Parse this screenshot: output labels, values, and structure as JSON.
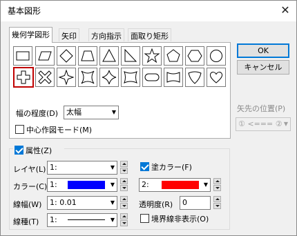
{
  "window": {
    "title": "基本図形",
    "close": "✕"
  },
  "tabs": [
    {
      "label": "幾何学図形"
    },
    {
      "label": "矢印"
    },
    {
      "label": "方向指示"
    },
    {
      "label": "面取り矩形"
    }
  ],
  "shapes": [
    {
      "icon": "rectangle-icon"
    },
    {
      "icon": "parallelogram-icon"
    },
    {
      "icon": "diamond-icon"
    },
    {
      "icon": "trapezoid-icon"
    },
    {
      "icon": "triangle-icon"
    },
    {
      "icon": "right-triangle-icon"
    },
    {
      "icon": "star-icon"
    },
    {
      "icon": "pentagon-icon"
    },
    {
      "icon": "hexagon-icon"
    },
    {
      "icon": "circle-icon"
    },
    {
      "icon": "cross-icon",
      "selected": true
    },
    {
      "icon": "x-cross-icon"
    },
    {
      "icon": "four-point-star-icon"
    },
    {
      "icon": "concave-square-icon"
    },
    {
      "icon": "concave-diamond-icon"
    },
    {
      "icon": "concave-rectangle-icon"
    },
    {
      "icon": "stadium-icon"
    },
    {
      "icon": "double-wave-icon"
    },
    {
      "icon": "shield-icon"
    },
    {
      "icon": "heart-icon"
    }
  ],
  "degree": {
    "label": "幅の程度(D)",
    "value": "太幅"
  },
  "center_mode": {
    "label": "中心作図モード(M)",
    "checked": false
  },
  "buttons": {
    "ok": "OK",
    "cancel": "キャンセル"
  },
  "arrow_position": {
    "label": "矢先の位置(P)",
    "value": "① <=== ②"
  },
  "attributes": {
    "label": "属性(Z)",
    "checked": true,
    "layer": {
      "label": "レイヤ(L)",
      "value": "1:"
    },
    "color": {
      "label": "カラー(C)",
      "value": "1:",
      "swatch": "#0000ff"
    },
    "line_width": {
      "label": "線幅(W)",
      "value": "1: 0.01"
    },
    "line_type": {
      "label": "線種(T)",
      "value": "1:"
    },
    "fill_color": {
      "label": "塗カラー(F)",
      "checked": true,
      "value": "2:",
      "swatch": "#ff0000"
    },
    "transparency": {
      "label": "透明度(R)",
      "value": "0"
    },
    "hide_border": {
      "label": "境界線非表示(O)",
      "checked": false
    }
  }
}
